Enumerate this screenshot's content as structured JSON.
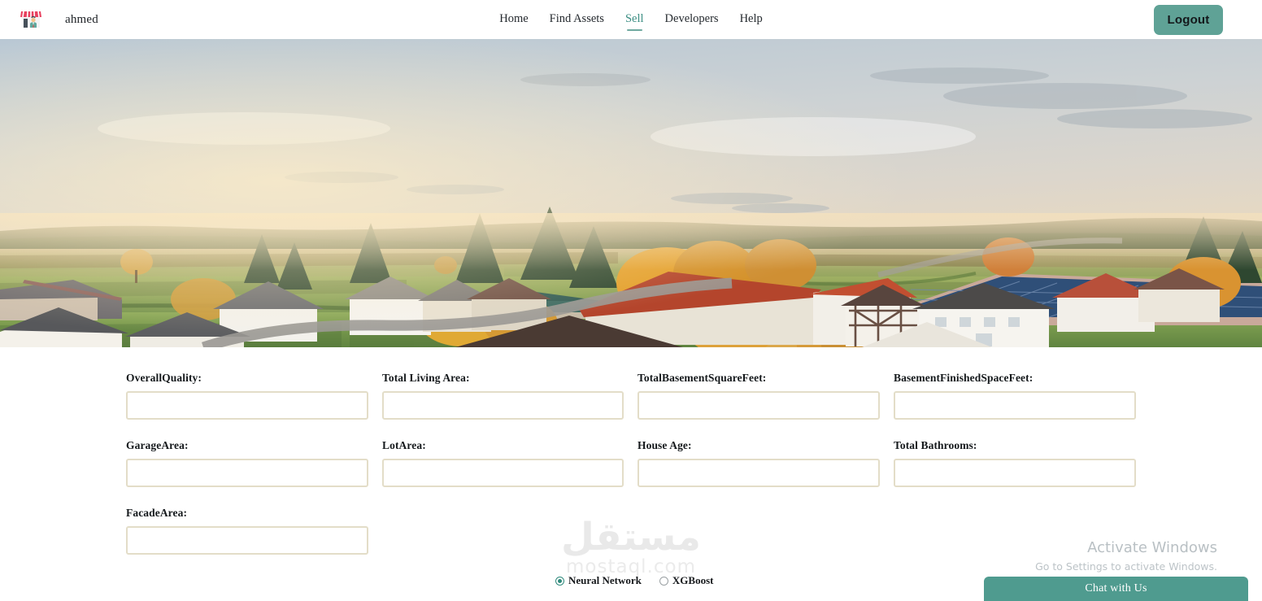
{
  "navbar": {
    "logo_icon": "convenience-store-icon",
    "brand_name": "ahmed",
    "links": [
      {
        "label": "Home",
        "active": false
      },
      {
        "label": "Find Assets",
        "active": false
      },
      {
        "label": "Sell",
        "active": true
      },
      {
        "label": "Developers",
        "active": false
      },
      {
        "label": "Help",
        "active": false
      }
    ],
    "logout_label": "Logout"
  },
  "hero": {
    "alt": "aerial photo of an autumn european village with green fields, red-roofed houses and hazy golden sunlight"
  },
  "form": {
    "fields": [
      {
        "label": "OverallQuality:",
        "value": "",
        "placeholder": ""
      },
      {
        "label": "Total Living Area:",
        "value": "",
        "placeholder": ""
      },
      {
        "label": "TotalBasementSquareFeet:",
        "value": "",
        "placeholder": ""
      },
      {
        "label": "BasementFinishedSpaceFeet:",
        "value": "",
        "placeholder": ""
      },
      {
        "label": "GarageArea:",
        "value": "",
        "placeholder": ""
      },
      {
        "label": "LotArea:",
        "value": "",
        "placeholder": ""
      },
      {
        "label": "House Age:",
        "value": "",
        "placeholder": ""
      },
      {
        "label": "Total Bathrooms:",
        "value": "",
        "placeholder": ""
      },
      {
        "label": "FacadeArea:",
        "value": "",
        "placeholder": ""
      }
    ],
    "model_options": [
      {
        "label": "Neural Network",
        "selected": true
      },
      {
        "label": "XGBoost",
        "selected": false
      }
    ]
  },
  "watermark": {
    "arabic": "مستقل",
    "latin": "mostaql.com"
  },
  "windows_activation": {
    "title": "Activate Windows",
    "subtitle": "Go to Settings to activate Windows."
  },
  "chat": {
    "label": "Chat with Us"
  },
  "colors": {
    "teal": "#5fa296",
    "chat_teal": "#4f9b8f",
    "input_border": "#e3ddc8",
    "active_link": "#3d8f84"
  }
}
